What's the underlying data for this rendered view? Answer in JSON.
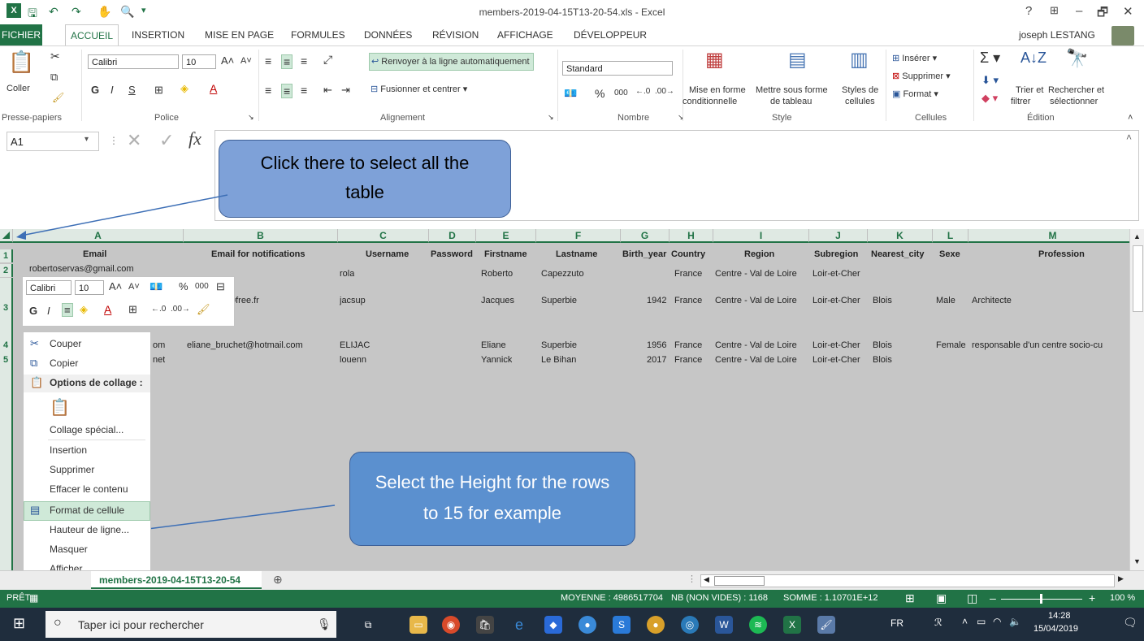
{
  "title_bar": {
    "title": "members-2019-04-15T13-20-54.xls - Excel",
    "help": "?",
    "minimize": "–",
    "restore": "🗗",
    "close": "✕",
    "user": "joseph LESTANG"
  },
  "tabs": [
    "FICHIER",
    "ACCUEIL",
    "INSERTION",
    "MISE EN PAGE",
    "FORMULES",
    "DONNÉES",
    "RÉVISION",
    "AFFICHAGE",
    "DÉVELOPPEUR"
  ],
  "ribbon": {
    "paste": "Coller",
    "group_clipboard": "Presse-papiers",
    "font_name": "Calibri",
    "font_size": "10",
    "group_font": "Police",
    "wrap_text": "Renvoyer à la ligne automatiquement",
    "merge_center": "Fusionner et centrer",
    "group_alignment": "Alignement",
    "number_format": "Standard",
    "percent": "%",
    "thousands": "000",
    "group_number": "Nombre",
    "cond_format_1": "Mise en forme",
    "cond_format_2": "conditionnelle",
    "table_format_1": "Mettre sous forme",
    "table_format_2": "de tableau",
    "cell_styles_1": "Styles de",
    "cell_styles_2": "cellules",
    "group_style": "Style",
    "insert": "Insérer",
    "delete": "Supprimer",
    "format": "Format",
    "group_cells": "Cellules",
    "sort_filter_1": "Trier et",
    "sort_filter_2": "filtrer",
    "find_select_1": "Rechercher et",
    "find_select_2": "sélectionner",
    "group_editing": "Édition"
  },
  "formula_bar": {
    "name_box": "A1",
    "fx": "fx"
  },
  "columns": [
    {
      "letter": "A",
      "header": "Email"
    },
    {
      "letter": "B",
      "header": "Email for notifications"
    },
    {
      "letter": "C",
      "header": "Username"
    },
    {
      "letter": "D",
      "header": "Password"
    },
    {
      "letter": "E",
      "header": "Firstname"
    },
    {
      "letter": "F",
      "header": "Lastname"
    },
    {
      "letter": "G",
      "header": "Birth_year"
    },
    {
      "letter": "H",
      "header": "Country"
    },
    {
      "letter": "I",
      "header": "Region"
    },
    {
      "letter": "J",
      "header": "Subregion"
    },
    {
      "letter": "K",
      "header": "Nearest_city"
    },
    {
      "letter": "L",
      "header": "Sexe"
    },
    {
      "letter": "M",
      "header": "Profession"
    }
  ],
  "row_numbers": [
    "1",
    "2",
    "3",
    "4",
    "5"
  ],
  "rows": [
    {
      "email": "robertoservas@gmail.com",
      "notif": "",
      "username": "rola",
      "firstname": "Roberto",
      "lastname": "Capezzuto",
      "birth": "",
      "country": "France",
      "region": "Centre - Val de Loire",
      "subregion": "Loir-et-Cher",
      "city": "",
      "sexe": "",
      "profession": ""
    },
    {
      "email": "0free.fr",
      "notif": "",
      "username": "jacsup",
      "firstname": "Jacques",
      "lastname": "Superbie",
      "birth": "1942",
      "country": "France",
      "region": "Centre - Val de Loire",
      "subregion": "Loir-et-Cher",
      "city": "Blois",
      "sexe": "Male",
      "profession": "Architecte"
    },
    {
      "email": "om",
      "notif": "eliane_bruchet@hotmail.com",
      "username": "ELIJAC",
      "firstname": "Eliane",
      "lastname": "Superbie",
      "birth": "1956",
      "country": "France",
      "region": "Centre - Val de Loire",
      "subregion": "Loir-et-Cher",
      "city": "Blois",
      "sexe": "Female",
      "profession": "responsable d'un centre socio-cu"
    },
    {
      "email": "net",
      "notif": "",
      "username": "louenn",
      "firstname": "Yannick",
      "lastname": "Le Bihan",
      "birth": "2017",
      "country": "France",
      "region": "Centre - Val de Loire",
      "subregion": "Loir-et-Cher",
      "city": "Blois",
      "sexe": "",
      "profession": ""
    }
  ],
  "mini_toolbar": {
    "font": "Calibri",
    "size": "10",
    "percent": "%",
    "thousands": "000"
  },
  "context_menu": {
    "cut": "Couper",
    "copy": "Copier",
    "paste_options": "Options de collage :",
    "paste_special": "Collage spécial...",
    "insert": "Insertion",
    "delete": "Supprimer",
    "clear": "Effacer le contenu",
    "format_cells": "Format de cellule",
    "row_height": "Hauteur de ligne...",
    "hide": "Masquer",
    "unhide": "Afficher"
  },
  "callouts": {
    "select_all": "Click there to select all the table",
    "row_height": "Select the Height for the rows to 15 for example"
  },
  "sheet_tab": "members-2019-04-15T13-20-54",
  "status": {
    "mode": "PRÊT",
    "average": "MOYENNE : 4986517704",
    "count": "NB (NON VIDES) : 1168",
    "sum": "SOMME : 1.10701E+12",
    "zoom": "100 %"
  },
  "taskbar": {
    "search": "Taper ici pour rechercher",
    "lang": "FR",
    "time": "14:28",
    "date": "15/04/2019"
  },
  "colors": {
    "excel_green": "#217346",
    "callout_top": "#7ea1d8",
    "callout_bottom": "#5b90cf"
  }
}
